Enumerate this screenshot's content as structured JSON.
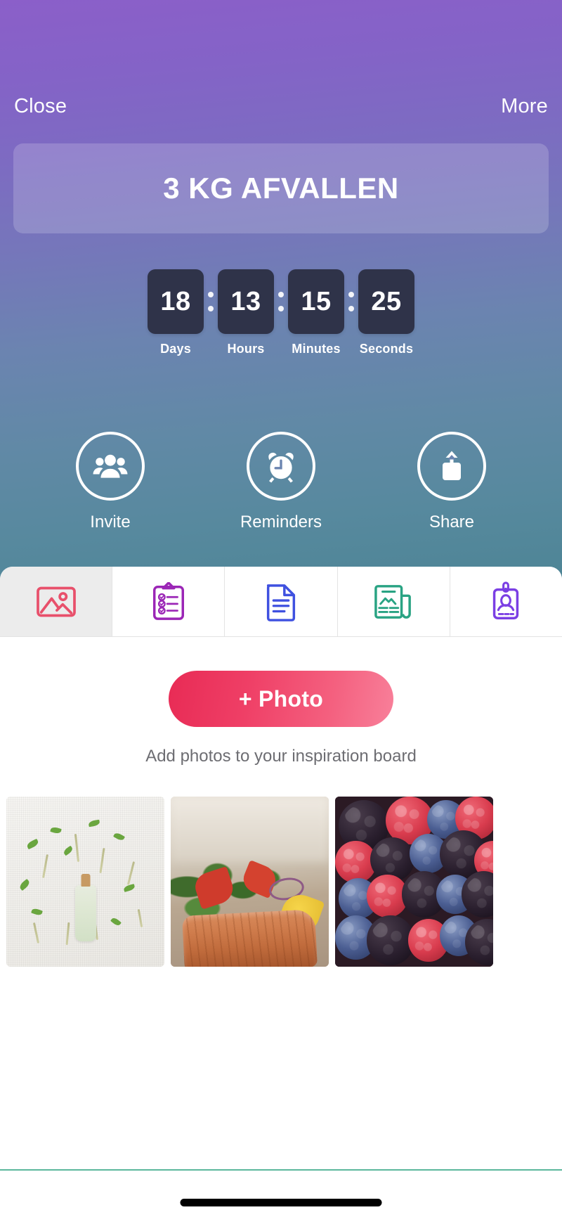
{
  "header": {
    "close_label": "Close",
    "more_label": "More",
    "title": "3 KG AFVALLEN",
    "gradient_top": "#8b5fc9",
    "gradient_bottom": "#4a8294"
  },
  "countdown": {
    "separator": ":",
    "units": [
      {
        "value": "18",
        "label": "Days"
      },
      {
        "value": "13",
        "label": "Hours"
      },
      {
        "value": "15",
        "label": "Minutes"
      },
      {
        "value": "25",
        "label": "Seconds"
      }
    ],
    "box_color": "#2f3349"
  },
  "actions": [
    {
      "label": "Invite",
      "icon": "people-icon"
    },
    {
      "label": "Reminders",
      "icon": "alarm-clock-icon"
    },
    {
      "label": "Share",
      "icon": "share-upload-icon"
    }
  ],
  "tabs": [
    {
      "name": "photos",
      "icon": "image-icon",
      "color": "#e8506b",
      "active": true
    },
    {
      "name": "checklist",
      "icon": "clipboard-checklist-icon",
      "color": "#9b26b6",
      "active": false
    },
    {
      "name": "notes",
      "icon": "document-icon",
      "color": "#3f51e0",
      "active": false
    },
    {
      "name": "articles",
      "icon": "newspaper-icon",
      "color": "#29a383",
      "active": false
    },
    {
      "name": "profile",
      "icon": "id-badge-icon",
      "color": "#7b3fe4",
      "active": false
    }
  ],
  "main": {
    "photo_button_label": "+ Photo",
    "photo_button_gradient": "#e82b55",
    "hint": "Add photos to your inspiration board",
    "photos": [
      {
        "alt": "herbs-flatlay-white-linen"
      },
      {
        "alt": "grilled-salmon-salad-plate"
      },
      {
        "alt": "mixed-berries-blackberry-blueberry-raspberry"
      }
    ]
  },
  "bottom": {
    "rule_color": "#5bb79c",
    "home_indicator": "home-indicator"
  }
}
